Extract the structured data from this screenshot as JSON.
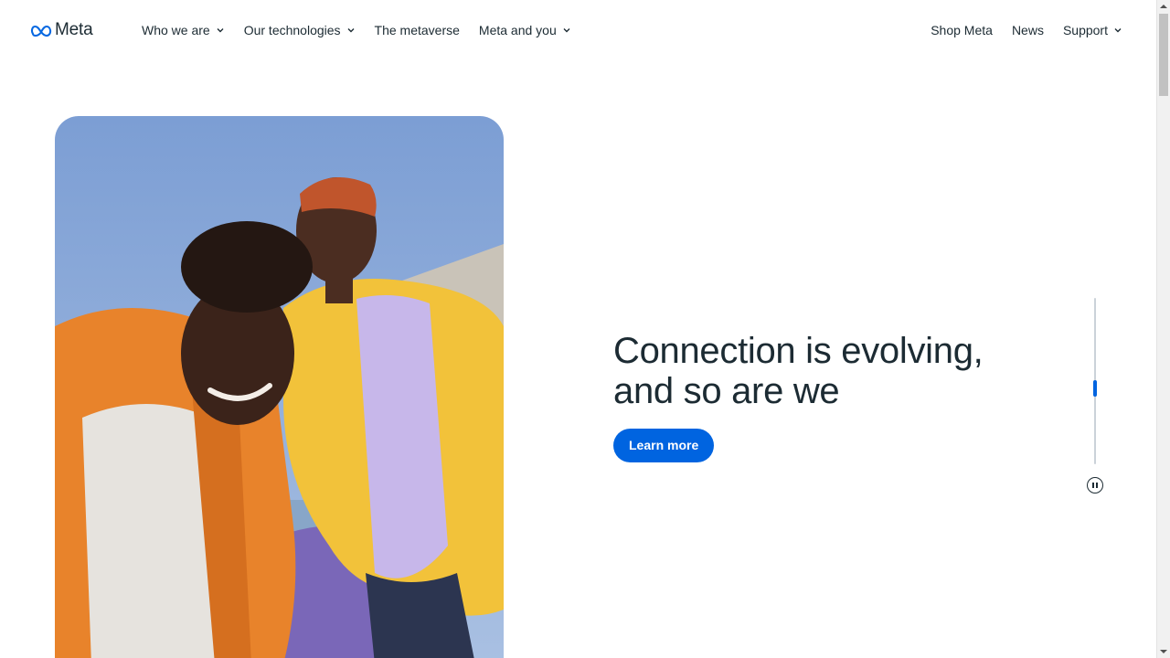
{
  "brand": {
    "name": "Meta",
    "logo_icon": "meta-infinity-icon",
    "logo_color": "#0668e1"
  },
  "nav": {
    "left": [
      {
        "label": "Who we are",
        "has_dropdown": true
      },
      {
        "label": "Our technologies",
        "has_dropdown": true
      },
      {
        "label": "The metaverse",
        "has_dropdown": false
      },
      {
        "label": "Meta and you",
        "has_dropdown": true
      }
    ],
    "right": [
      {
        "label": "Shop Meta",
        "has_dropdown": false
      },
      {
        "label": "News",
        "has_dropdown": false
      },
      {
        "label": "Support",
        "has_dropdown": true
      }
    ]
  },
  "hero": {
    "heading_line1": "Connection is evolving,",
    "heading_line2": "and so are we",
    "cta_label": "Learn more",
    "cta_color": "#0064e0",
    "image": "two-smiling-men-selfie-photo"
  },
  "carousel": {
    "progress": 0.55,
    "pause_icon": "pause-icon"
  },
  "colors": {
    "text": "#1c2b33",
    "accent": "#0064e0",
    "track": "#cbd2d9"
  }
}
